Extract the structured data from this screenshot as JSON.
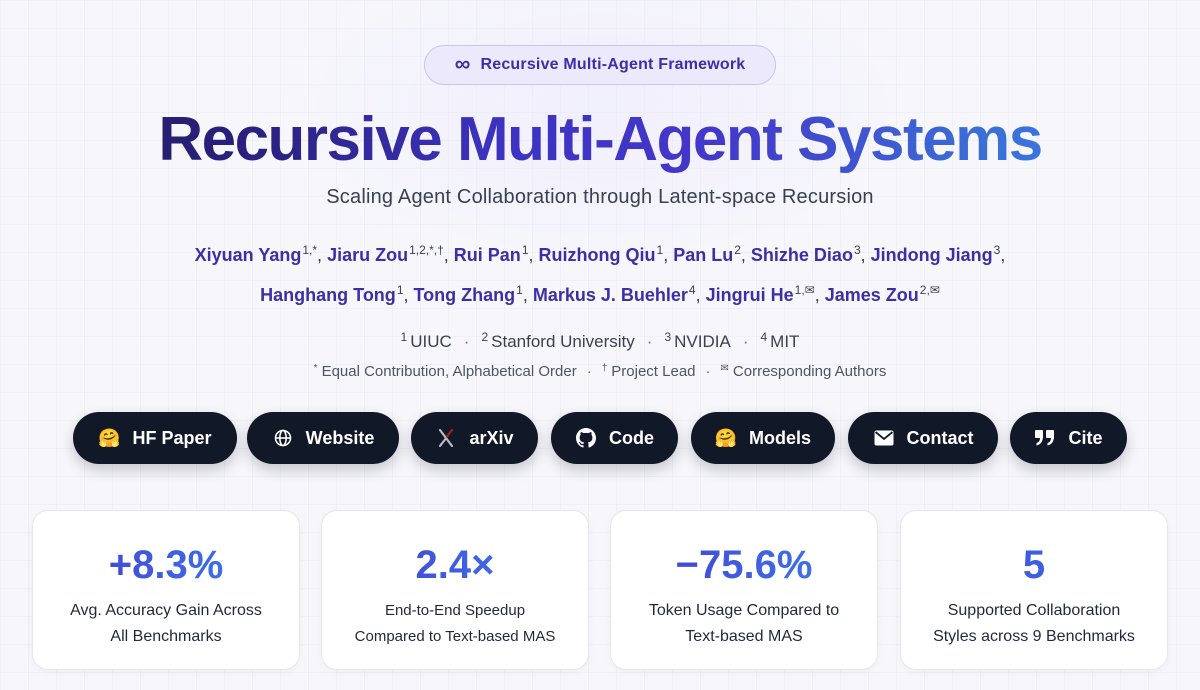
{
  "badge": {
    "icon": "infinity-icon",
    "label": "Recursive Multi-Agent Framework"
  },
  "title": {
    "part1": "Recursive",
    "part2": "Multi-Agent",
    "part3": "Systems"
  },
  "subtitle": "Scaling Agent Collaboration through Latent-space Recursion",
  "authors_row1": [
    {
      "name": "Xiyuan Yang",
      "sup": "1,*"
    },
    {
      "name": "Jiaru Zou",
      "sup": "1,2,*,†"
    },
    {
      "name": "Rui Pan",
      "sup": "1"
    },
    {
      "name": "Ruizhong Qiu",
      "sup": "1"
    },
    {
      "name": "Pan Lu",
      "sup": "2"
    },
    {
      "name": "Shizhe Diao",
      "sup": "3"
    },
    {
      "name": "Jindong Jiang",
      "sup": "3"
    }
  ],
  "authors_row2": [
    {
      "name": "Hanghang Tong",
      "sup": "1"
    },
    {
      "name": "Tong Zhang",
      "sup": "1"
    },
    {
      "name": "Markus J. Buehler",
      "sup": "4"
    },
    {
      "name": "Jingrui He",
      "sup": "1,✉"
    },
    {
      "name": "James Zou",
      "sup": "2,✉"
    }
  ],
  "affiliations": [
    {
      "sup": "1",
      "name": "UIUC"
    },
    {
      "sup": "2",
      "name": "Stanford University"
    },
    {
      "sup": "3",
      "name": "NVIDIA"
    },
    {
      "sup": "4",
      "name": "MIT"
    }
  ],
  "notes": [
    {
      "sup": "*",
      "text": "Equal Contribution, Alphabetical Order"
    },
    {
      "sup": "†",
      "text": "Project Lead"
    },
    {
      "sup": "✉",
      "text": "Corresponding Authors"
    }
  ],
  "buttons": [
    {
      "id": "hf-paper",
      "icon": "hugging-face-icon",
      "glyph": "🤗",
      "label": "HF Paper"
    },
    {
      "id": "website",
      "icon": "globe-icon",
      "glyph": "",
      "label": "Website"
    },
    {
      "id": "arxiv",
      "icon": "arxiv-icon",
      "glyph": "",
      "label": "arXiv"
    },
    {
      "id": "code",
      "icon": "github-icon",
      "glyph": "",
      "label": "Code"
    },
    {
      "id": "models",
      "icon": "hugging-face-icon",
      "glyph": "🤗",
      "label": "Models"
    },
    {
      "id": "contact",
      "icon": "envelope-icon",
      "glyph": "",
      "label": "Contact"
    },
    {
      "id": "cite",
      "icon": "quote-icon",
      "glyph": "",
      "label": "Cite"
    }
  ],
  "stats": [
    {
      "value": "+8.3%",
      "label": "Avg. Accuracy Gain Across\nAll Benchmarks"
    },
    {
      "value": "2.4×",
      "label": "End-to-End Speedup\nCompared to Text-based MAS"
    },
    {
      "value": "−75.6%",
      "label": "Token Usage Compared to\nText-based MAS"
    },
    {
      "value": "5",
      "label": "Supported Collaboration\nStyles across 9 Benchmarks"
    }
  ],
  "colors": {
    "accent": "#3b2fa8",
    "button_bg": "#111827",
    "gradient_start": "#4338ca",
    "gradient_end": "#3b82f6"
  }
}
